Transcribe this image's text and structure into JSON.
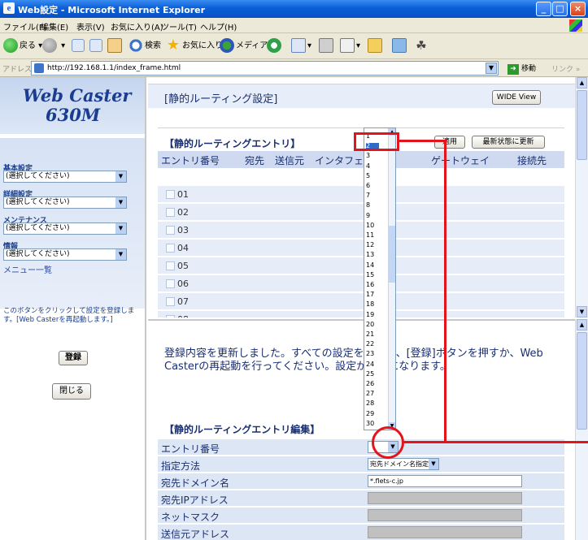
{
  "window": {
    "title": "Web設定 - Microsoft Internet Explorer"
  },
  "menubar": [
    "ファイル(F)",
    "編集(E)",
    "表示(V)",
    "お気に入り(A)",
    "ツール(T)",
    "ヘルプ(H)"
  ],
  "toolbar": {
    "back": "戻る",
    "search": "検索",
    "favorites": "お気に入り",
    "media": "メディア"
  },
  "address": {
    "label": "アドレス(D)",
    "url": "http://192.168.1.1/index_frame.html",
    "go": "移動",
    "links": "リンク »"
  },
  "sidebar": {
    "logo_line1": "Web Caster",
    "logo_line2": "630M",
    "groups": [
      {
        "label": "基本設定",
        "select": "(選択してください)"
      },
      {
        "label": "詳細設定",
        "select": "(選択してください)"
      },
      {
        "label": "メンテナンス",
        "select": "(選択してください)"
      },
      {
        "label": "情報",
        "select": "(選択してください)"
      }
    ],
    "menu_link": "メニュー一覧",
    "note": "このボタンをクリックして設定を登録します。[Web Casterを再起動します。]",
    "register_button": "登録",
    "close_button": "閉じる"
  },
  "main": {
    "title": "[静的ルーティング設定]",
    "wide_view": "WIDE View",
    "entry_title": "【静的ルーティングエントリ】",
    "apply": "適用",
    "refresh": "最新状態に更新",
    "columns": [
      "エントリ番号",
      "宛先",
      "送信元",
      "インタフェース",
      "ゲートウェイ",
      "接続先"
    ],
    "rows": [
      "01",
      "02",
      "03",
      "04",
      "05",
      "06",
      "07",
      "08"
    ]
  },
  "dropdown": {
    "options": [
      "1",
      "2",
      "3",
      "4",
      "5",
      "6",
      "7",
      "8",
      "9",
      "10",
      "11",
      "12",
      "13",
      "14",
      "15",
      "16",
      "17",
      "18",
      "19",
      "20",
      "21",
      "22",
      "23",
      "24",
      "25",
      "26",
      "27",
      "28",
      "29",
      "30"
    ],
    "selected": "2"
  },
  "bottom": {
    "message": "登録内容を更新しました。すべての設定を終了後、[登録]ボタンを押すか、Web Casterの再起動を行ってください。設定が有効になります。",
    "edit_title": "【静的ルーティングエントリ編集】",
    "fields": [
      {
        "label": "エントリ番号",
        "value": ""
      },
      {
        "label": "指定方法",
        "value": "宛先ドメイン名指定"
      },
      {
        "label": "宛先ドメイン名",
        "value": "*.flets-c.jp"
      },
      {
        "label": "宛先IPアドレス",
        "value": ""
      },
      {
        "label": "ネットマスク",
        "value": ""
      },
      {
        "label": "送信元アドレス",
        "value": ""
      }
    ]
  },
  "colors": {
    "accent": "#e4141c",
    "header_blue": "#0a5fd8",
    "table_header": "#cfdaf0"
  }
}
